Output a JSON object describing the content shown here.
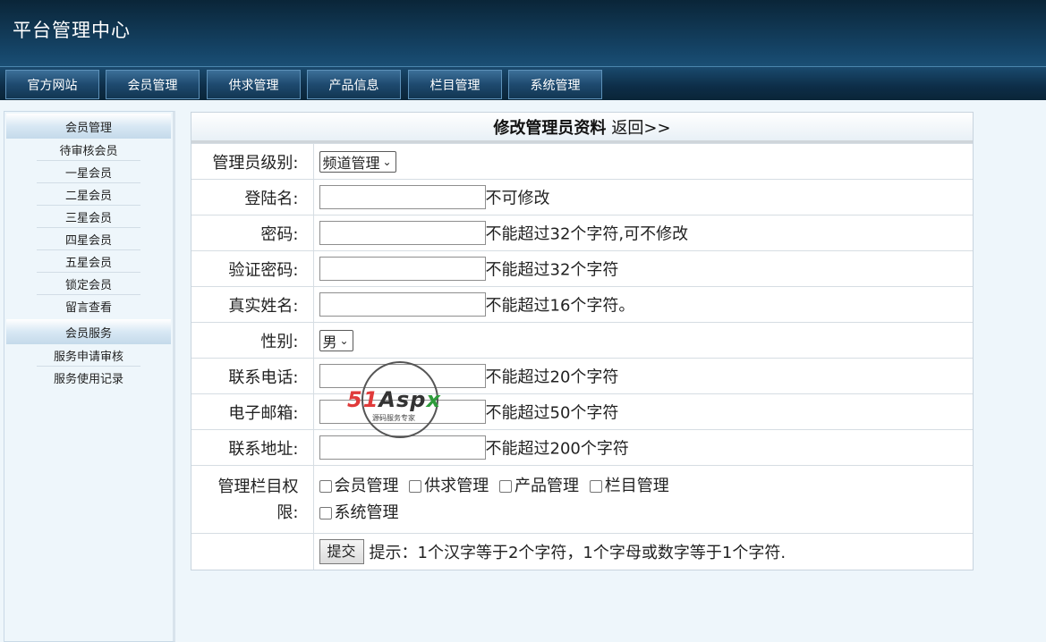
{
  "header": {
    "title": "平台管理中心"
  },
  "nav": [
    {
      "label": "官方网站"
    },
    {
      "label": "会员管理"
    },
    {
      "label": "供求管理"
    },
    {
      "label": "产品信息"
    },
    {
      "label": "栏目管理"
    },
    {
      "label": "系统管理"
    }
  ],
  "sidebar": {
    "section1": {
      "title": "会员管理",
      "items": [
        "待审核会员",
        "一星会员",
        "二星会员",
        "三星会员",
        "四星会员",
        "五星会员",
        "锁定会员",
        "留言查看"
      ]
    },
    "section2": {
      "title": "会员服务",
      "items": [
        "服务申请审核",
        "服务使用记录"
      ]
    }
  },
  "form": {
    "title": "修改管理员资料",
    "back_link": "返回>>",
    "level_label": "管理员级别:",
    "level_value": "频道管理",
    "login_label": "登陆名:",
    "login_hint": "不可修改",
    "password_label": "密码:",
    "password_hint": "不能超过32个字符,可不修改",
    "confirm_label": "验证密码:",
    "confirm_hint": "不能超过32个字符",
    "realname_label": "真实姓名:",
    "realname_hint": "不能超过16个字符。",
    "gender_label": "性别:",
    "gender_value": "男",
    "phone_label": "联系电话:",
    "phone_hint": "不能超过20个字符",
    "email_label": "电子邮箱:",
    "email_hint": "不能超过50个字符",
    "address_label": "联系地址:",
    "address_hint": "不能超过200个字符",
    "perm_label_line1": "管理栏目权",
    "perm_label_line2": "限:",
    "permissions": [
      "会员管理",
      "供求管理",
      "产品管理",
      "栏目管理",
      "系统管理"
    ],
    "submit_label": "提交",
    "tip": "提示：1个汉字等于2个字符，1个字母或数字等于1个字符."
  },
  "watermark": {
    "brand": "51Aspx",
    "sub": "源码服务专家"
  }
}
